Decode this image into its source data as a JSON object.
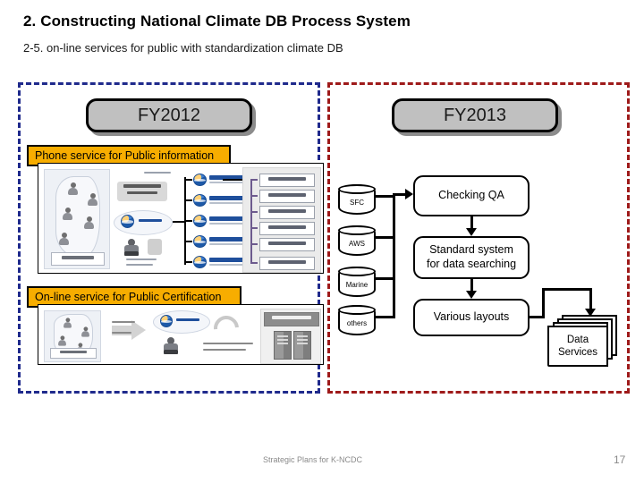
{
  "header": {
    "title": "2. Constructing National Climate DB Process System",
    "subtitle": "2-5. on-line services for public with standardization climate DB"
  },
  "panels": {
    "left": {
      "name": "FY2012",
      "border_color": "#1f2a8c"
    },
    "right": {
      "name": "FY2013",
      "border_color": "#9e1a1a"
    }
  },
  "fy2012": {
    "pill_label": "FY2012",
    "sections": [
      {
        "label": "Phone service for Public information"
      },
      {
        "label": "On-line service for Public Certification"
      }
    ],
    "label_color": "#f7ad00",
    "phone_diagram": {
      "map_caption": "전국 대표번호",
      "ars_note": "ARS 호 분배",
      "hq_box": "기상청 본청\n민원 대표번호",
      "center_logo": "기상청",
      "switch_caption": "기상청\n교환교환기",
      "regional_offices": [
        "부산지방기상청",
        "광주지방기상청",
        "대전지방기상청",
        "강원지방기상청",
        "제주지방기상청"
      ],
      "stations": [
        "대구기상대",
        "구미기상대",
        "포항기상대",
        "안동기상대",
        "상주기상대",
        "통영기상대"
      ]
    },
    "online_diagram": {
      "map_caption": "전국",
      "arrow_caption": "전날기증\n상시접수",
      "center_logo": "기상청",
      "process_caption": "증명서 발시스템을 통산\n민원접수, 의료, 발급",
      "server_title": "전자민원시스템"
    }
  },
  "fy2013": {
    "pill_label": "FY2013",
    "databases": [
      {
        "label": "SFC"
      },
      {
        "label": "AWS"
      },
      {
        "label": "Marine"
      },
      {
        "label": "others"
      }
    ],
    "flow_boxes": [
      {
        "id": "checking-qa",
        "label": "Checking QA"
      },
      {
        "id": "standard-system",
        "label": "Standard system\nfor data searching"
      },
      {
        "id": "various-layouts",
        "label": "Various layouts"
      }
    ],
    "output": {
      "label": "Data\nServices"
    }
  },
  "footer": {
    "text": "Strategic Plans for K-NCDC",
    "page": "17"
  }
}
